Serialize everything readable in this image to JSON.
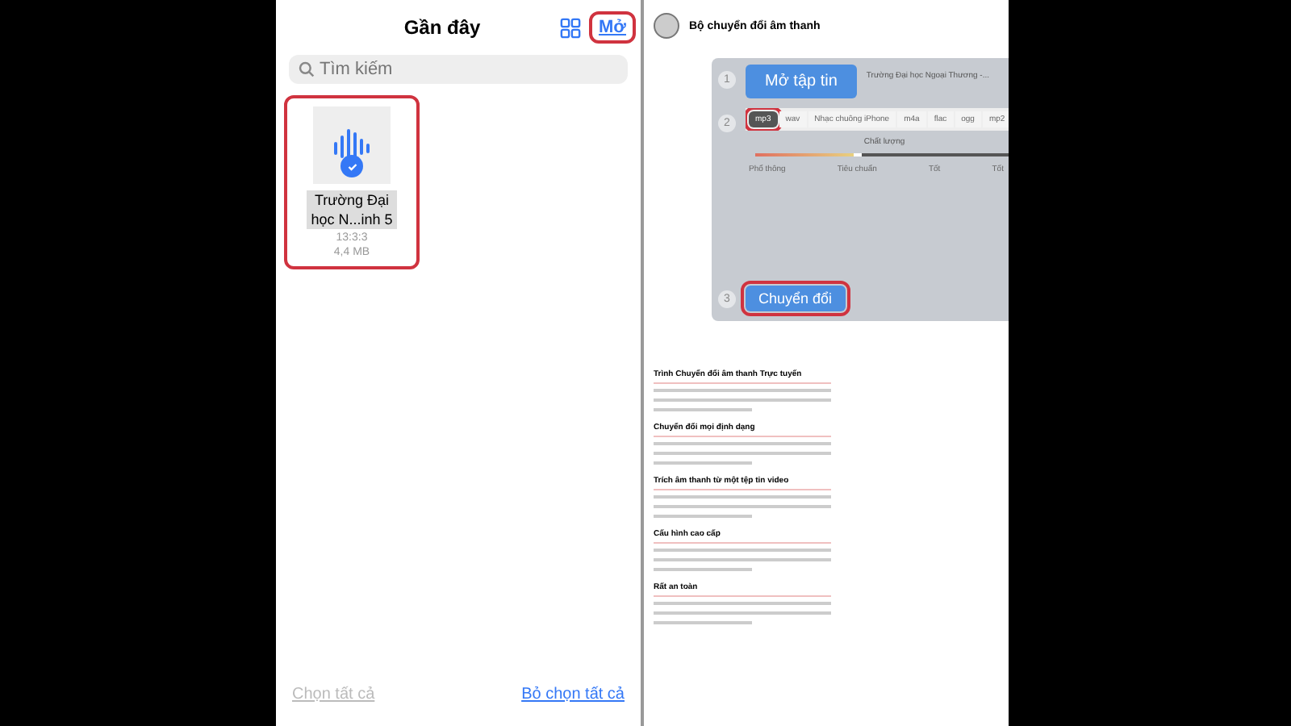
{
  "files_panel": {
    "title": "Gần đây",
    "open_link": {
      "label": "Mở",
      "highlighted": true
    },
    "search": {
      "placeholder": "Tìm kiếm"
    },
    "files": [
      {
        "name": "Trường Đại học N...inh 5",
        "time": "13:3:3",
        "size": "4,4 MB",
        "selected": true,
        "highlighted": true
      }
    ],
    "footer": [
      {
        "label": "Chọn tất cả",
        "disabled": true
      },
      {
        "label": "Bỏ chọn tất cả",
        "disabled": false
      }
    ]
  },
  "converter": {
    "title": "Bộ chuyển đổi âm thanh",
    "steps": [
      {
        "number": "1",
        "kind": "open",
        "button": "Mở tập tin",
        "file": "Trường Đại học Ngoại Thương -..."
      },
      {
        "number": "2",
        "kind": "format",
        "formats": [
          {
            "label": "mp3",
            "selected": true,
            "highlighted": true
          },
          {
            "label": "wav",
            "selected": false,
            "highlighted": false
          },
          {
            "label": "Nhạc chuông iPhone",
            "selected": false,
            "highlighted": false
          },
          {
            "label": "m4a",
            "selected": false,
            "highlighted": false
          },
          {
            "label": "flac",
            "selected": false,
            "highlighted": false
          },
          {
            "label": "ogg",
            "selected": false,
            "highlighted": false
          },
          {
            "label": "mp2",
            "selected": false,
            "highlighted": false
          }
        ],
        "quality_label": "Chất lượng",
        "level": 0.38,
        "quality_marks": [
          "Phổ thông",
          "Tiêu chuẩn",
          "Tốt",
          "Tốt"
        ]
      },
      {
        "number": "3",
        "kind": "convert",
        "button": "Chuyển đổi",
        "highlighted": true
      }
    ],
    "sections": [
      {
        "heading": "Trình Chuyển đổi âm thanh Trực tuyến"
      },
      {
        "heading": "Chuyển đổi mọi định dạng"
      },
      {
        "heading": "Trích âm thanh từ một tệp tin video"
      },
      {
        "heading": "Cấu hình cao cấp"
      },
      {
        "heading": "Rất an toàn"
      }
    ]
  }
}
